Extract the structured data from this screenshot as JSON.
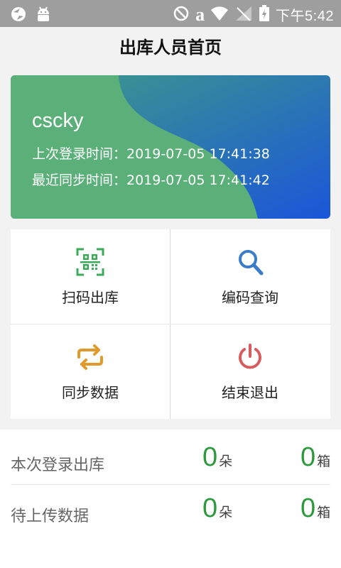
{
  "status_bar": {
    "time": "下午5:42",
    "a_glyph": "a",
    "colors": {
      "background": "#9e9e9e"
    },
    "icons": [
      "sync-icon",
      "android-icon",
      "no-disturb-icon",
      "wifi-icon",
      "signal-icon",
      "battery-icon"
    ]
  },
  "header": {
    "title": "出库人员首页"
  },
  "user_card": {
    "username": "cscky",
    "last_login": "上次登录时间：2019-07-05 17:41:38",
    "last_sync": "最近同步时间：2019-07-05 17:41:42",
    "colors": {
      "green": "#5bb07a",
      "blue": "#1a56d9",
      "teal": "#3f9c86"
    }
  },
  "menu": {
    "scan_out": {
      "label": "扫码出库",
      "icon": "qr-scan-icon",
      "color": "#3daa5a"
    },
    "code_query": {
      "label": "编码查询",
      "icon": "search-icon",
      "color": "#3b7cc9"
    },
    "sync_data": {
      "label": "同步数据",
      "icon": "sync-arrows-icon",
      "color": "#e09a2c"
    },
    "exit": {
      "label": "结束退出",
      "icon": "power-icon",
      "color": "#d95c5c"
    }
  },
  "stats": {
    "session": {
      "label": "本次登录出库",
      "count1": "0",
      "unit1": "朵",
      "count2": "0",
      "unit2": "箱"
    },
    "pending": {
      "label": "待上传数据",
      "count1": "0",
      "unit1": "朵",
      "count2": "0",
      "unit2": "箱"
    },
    "colors": {
      "number": "#2e9a3e"
    }
  }
}
